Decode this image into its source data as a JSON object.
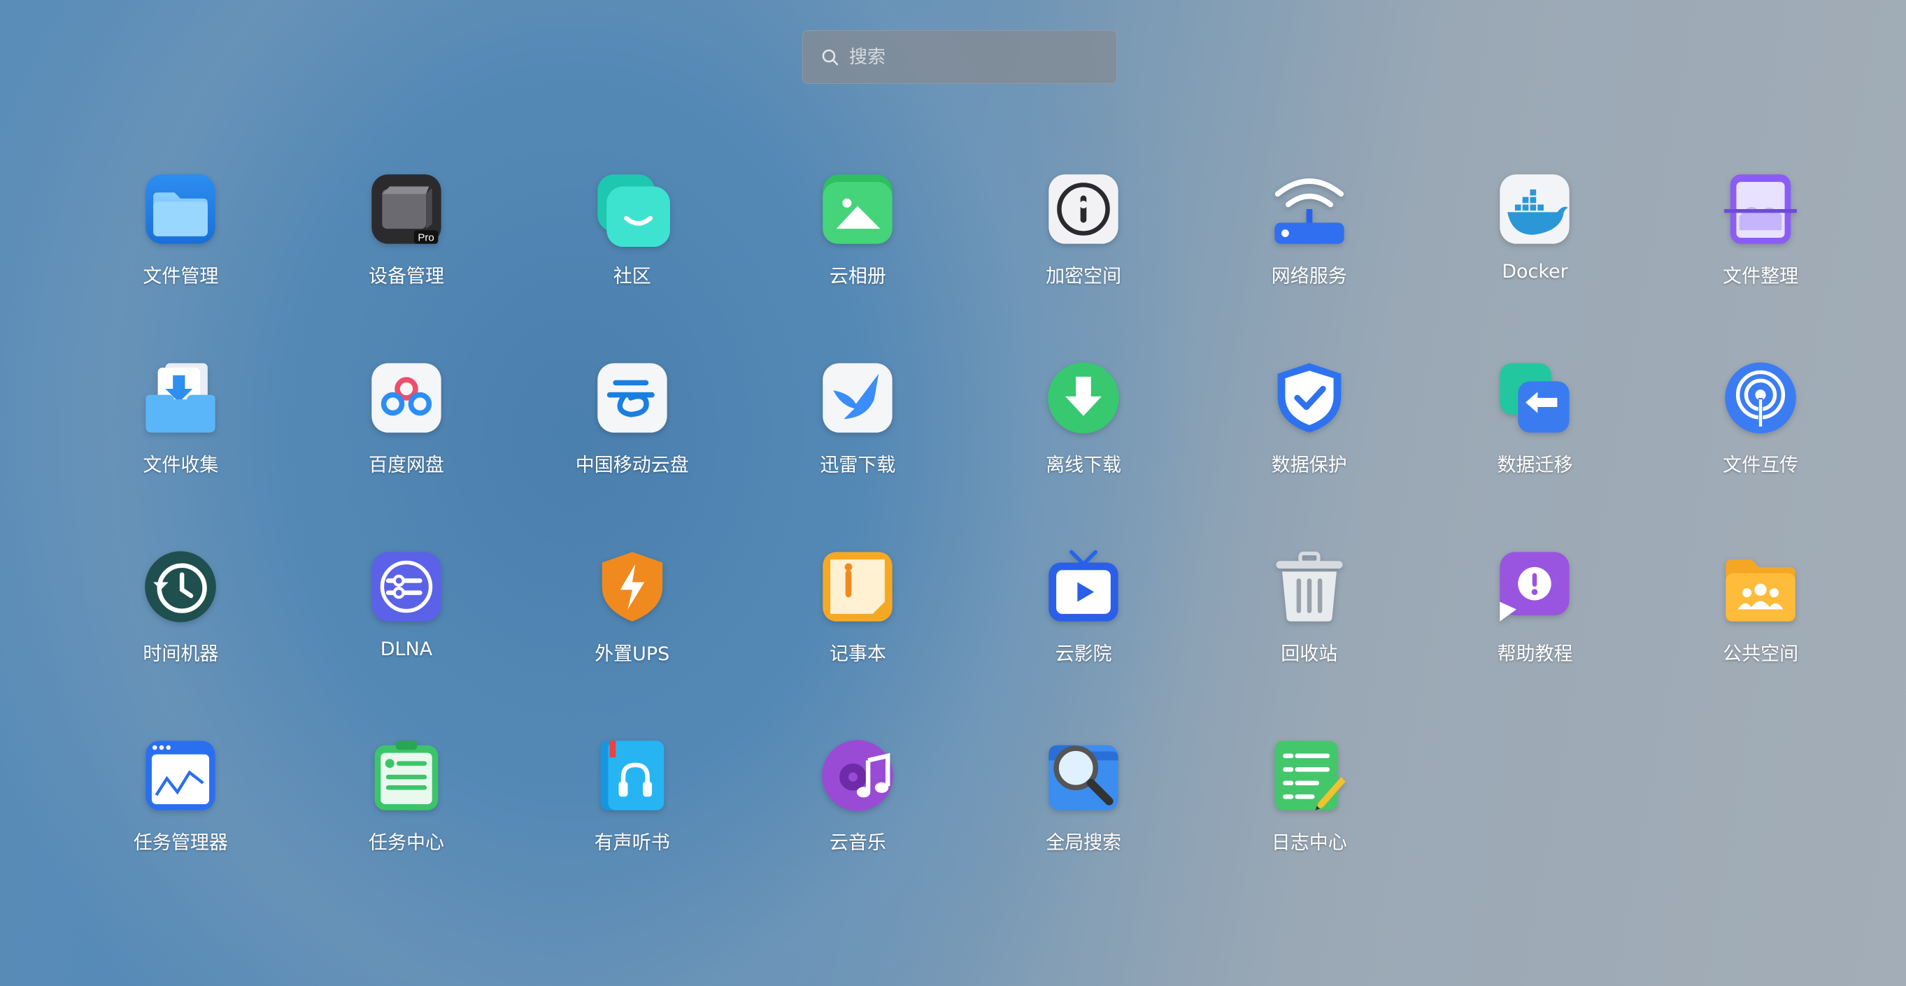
{
  "search": {
    "placeholder": "搜索"
  },
  "apps": [
    {
      "label": "文件管理",
      "icon": "folder-icon"
    },
    {
      "label": "设备管理",
      "icon": "nas-device-icon",
      "badge": "Pro"
    },
    {
      "label": "社区",
      "icon": "community-chat-icon"
    },
    {
      "label": "云相册",
      "icon": "cloud-album-icon"
    },
    {
      "label": "加密空间",
      "icon": "lock-dial-icon"
    },
    {
      "label": "网络服务",
      "icon": "wifi-router-icon"
    },
    {
      "label": "Docker",
      "icon": "docker-whale-icon"
    },
    {
      "label": "文件整理",
      "icon": "file-organize-icon"
    },
    {
      "label": "文件收集",
      "icon": "file-collect-icon"
    },
    {
      "label": "百度网盘",
      "icon": "baidu-netdisk-icon"
    },
    {
      "label": "中国移动云盘",
      "icon": "cmcc-cloud-icon"
    },
    {
      "label": "迅雷下载",
      "icon": "thunder-bird-icon"
    },
    {
      "label": "离线下载",
      "icon": "offline-download-icon"
    },
    {
      "label": "数据保护",
      "icon": "shield-check-icon"
    },
    {
      "label": "数据迁移",
      "icon": "data-migrate-icon"
    },
    {
      "label": "文件互传",
      "icon": "airdrop-icon"
    },
    {
      "label": "时间机器",
      "icon": "time-machine-icon"
    },
    {
      "label": "DLNA",
      "icon": "dlna-icon"
    },
    {
      "label": "外置UPS",
      "icon": "ups-bolt-icon"
    },
    {
      "label": "记事本",
      "icon": "notepad-icon"
    },
    {
      "label": "云影院",
      "icon": "tv-play-icon"
    },
    {
      "label": "回收站",
      "icon": "trash-icon"
    },
    {
      "label": "帮助教程",
      "icon": "help-bubble-icon"
    },
    {
      "label": "公共空间",
      "icon": "shared-folder-icon"
    },
    {
      "label": "任务管理器",
      "icon": "task-monitor-icon"
    },
    {
      "label": "任务中心",
      "icon": "task-clipboard-icon"
    },
    {
      "label": "有声听书",
      "icon": "audiobook-icon"
    },
    {
      "label": "云音乐",
      "icon": "music-disc-icon"
    },
    {
      "label": "全局搜索",
      "icon": "global-search-icon"
    },
    {
      "label": "日志中心",
      "icon": "log-pencil-icon"
    }
  ]
}
